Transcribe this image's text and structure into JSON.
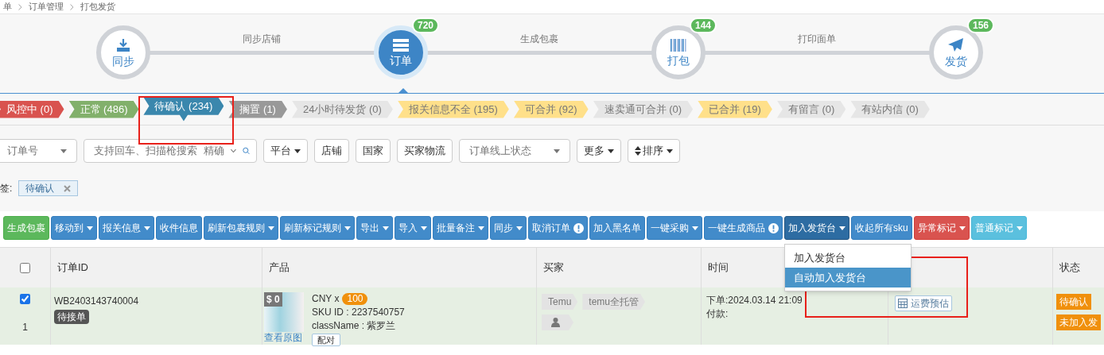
{
  "breadcrumb": [
    "单",
    "订单管理",
    "打包发货"
  ],
  "workflow": {
    "steps": [
      {
        "label": "同步",
        "selected": false
      },
      {
        "label": "订单",
        "count": "720",
        "selected": true
      },
      {
        "label": "打包",
        "count": "144",
        "selected": false
      },
      {
        "label": "发货",
        "count": "156",
        "selected": false
      }
    ],
    "connectors": [
      "同步店铺",
      "生成包裹",
      "打印面单"
    ]
  },
  "status_tags": [
    {
      "label": "风控中 (0)",
      "color": "#d9534f",
      "selected": false
    },
    {
      "label": "正常 (486)",
      "color": "#82b06b",
      "selected": false
    },
    {
      "label": "待确认 (234)",
      "color": "#3a87ad",
      "selected": true
    },
    {
      "label": "搁置 (1)",
      "color": "#999999",
      "selected": false
    },
    {
      "label": "24小时待发货 (0)",
      "color": "#e6e6e6",
      "selected": false
    },
    {
      "label": "报关信息不全 (195)",
      "color": "#ffe08a",
      "selected": false
    },
    {
      "label": "可合并 (92)",
      "color": "#ffe08a",
      "selected": false
    },
    {
      "label": "速卖通可合并 (0)",
      "color": "#e6e6e6",
      "selected": false
    },
    {
      "label": "已合并 (19)",
      "color": "#ffe08a",
      "selected": false
    },
    {
      "label": "有留言 (0)",
      "color": "#e6e6e6",
      "selected": false
    },
    {
      "label": "有站内信 (0)",
      "color": "#e6e6e6",
      "selected": false
    }
  ],
  "filters": [
    {
      "kind": "select",
      "label": "订单号"
    },
    {
      "kind": "search",
      "placeholder": "支持回车、扫描枪搜索",
      "mode": "精确"
    },
    {
      "kind": "button",
      "label": "平台",
      "caret": true
    },
    {
      "kind": "button",
      "label": "店铺",
      "caret": false
    },
    {
      "kind": "button",
      "label": "国家",
      "caret": false
    },
    {
      "kind": "button",
      "label": "买家物流",
      "caret": false
    },
    {
      "kind": "select",
      "label": "订单线上状态"
    },
    {
      "kind": "button",
      "label": "更多",
      "caret": true
    },
    {
      "kind": "sort",
      "label": "排序",
      "caret": true
    }
  ],
  "active_filter": {
    "label": "签:",
    "chip": "待确认"
  },
  "toolbar": [
    {
      "label": "生成包裹",
      "kind": "success",
      "caret": false,
      "alert": false,
      "selected": false
    },
    {
      "label": "移动到",
      "kind": "primary",
      "caret": true,
      "alert": false,
      "selected": false
    },
    {
      "label": "报关信息",
      "kind": "primary",
      "caret": true,
      "alert": false,
      "selected": false
    },
    {
      "label": "收件信息",
      "kind": "primary",
      "caret": false,
      "alert": false,
      "selected": false
    },
    {
      "label": "刷新包裹规则",
      "kind": "primary",
      "caret": true,
      "alert": false,
      "selected": false
    },
    {
      "label": "刷新标记规则",
      "kind": "primary",
      "caret": true,
      "alert": false,
      "selected": false
    },
    {
      "label": "导出",
      "kind": "primary",
      "caret": true,
      "alert": false,
      "selected": false
    },
    {
      "label": "导入",
      "kind": "primary",
      "caret": true,
      "alert": false,
      "selected": false
    },
    {
      "label": "批量备注",
      "kind": "primary",
      "caret": true,
      "alert": false,
      "selected": false
    },
    {
      "label": "同步",
      "kind": "primary",
      "caret": true,
      "alert": false,
      "selected": false
    },
    {
      "label": "取消订单",
      "kind": "primary",
      "caret": false,
      "alert": true,
      "selected": false
    },
    {
      "label": "加入黑名单",
      "kind": "primary",
      "caret": false,
      "alert": false,
      "selected": false
    },
    {
      "label": "一键采购",
      "kind": "primary",
      "caret": true,
      "alert": false,
      "selected": false
    },
    {
      "label": "一键生成商品",
      "kind": "primary",
      "caret": false,
      "alert": true,
      "selected": false
    },
    {
      "label": "加入发货台",
      "kind": "primary",
      "caret": true,
      "alert": false,
      "selected": true
    },
    {
      "label": "收起所有sku",
      "kind": "primary",
      "caret": false,
      "alert": false,
      "selected": false
    },
    {
      "label": "异常标记",
      "kind": "danger",
      "caret": true,
      "alert": false,
      "selected": false
    },
    {
      "label": "普通标记",
      "kind": "info",
      "caret": true,
      "alert": false,
      "selected": false
    }
  ],
  "dropdown_menu": [
    {
      "label": "加入发货台",
      "selected": false
    },
    {
      "label": "自动加入发货台",
      "selected": true
    }
  ],
  "table": {
    "select_all_checked": false,
    "columns": [
      "订单ID",
      "产品",
      "买家",
      "时间",
      "状态"
    ],
    "rows": [
      {
        "checked": true,
        "index": "1",
        "order_id": "WB2403143740004",
        "order_badge": "待接单",
        "price_tag": "$ 0",
        "currency": "CNY x",
        "quantity": "100",
        "sku": "SKU ID : 2237540757",
        "class_name": "className : 紫罗兰",
        "view_image": "查看原图",
        "pair": "配对",
        "buyer_tags": [
          "Temu",
          "temu全托管"
        ],
        "ordered": "下单:2024.03.14 21:09",
        "paid": "付款:",
        "shipping_estimate": "运费预估",
        "status": [
          "待确认",
          "未加入发"
        ]
      }
    ]
  }
}
